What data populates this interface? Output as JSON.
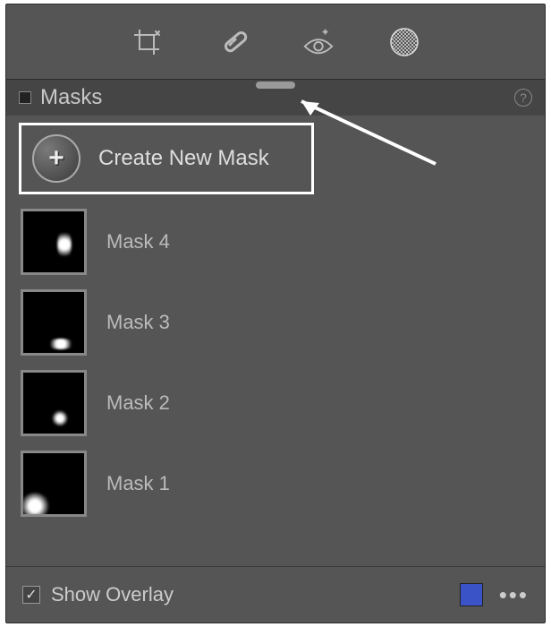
{
  "header": {
    "title": "Masks"
  },
  "create": {
    "label": "Create New Mask"
  },
  "masks": [
    {
      "label": "Mask 4"
    },
    {
      "label": "Mask 3"
    },
    {
      "label": "Mask 2"
    },
    {
      "label": "Mask 1"
    }
  ],
  "footer": {
    "show_overlay_label": "Show Overlay",
    "show_overlay_checked": true,
    "overlay_color": "#3a54c7"
  }
}
